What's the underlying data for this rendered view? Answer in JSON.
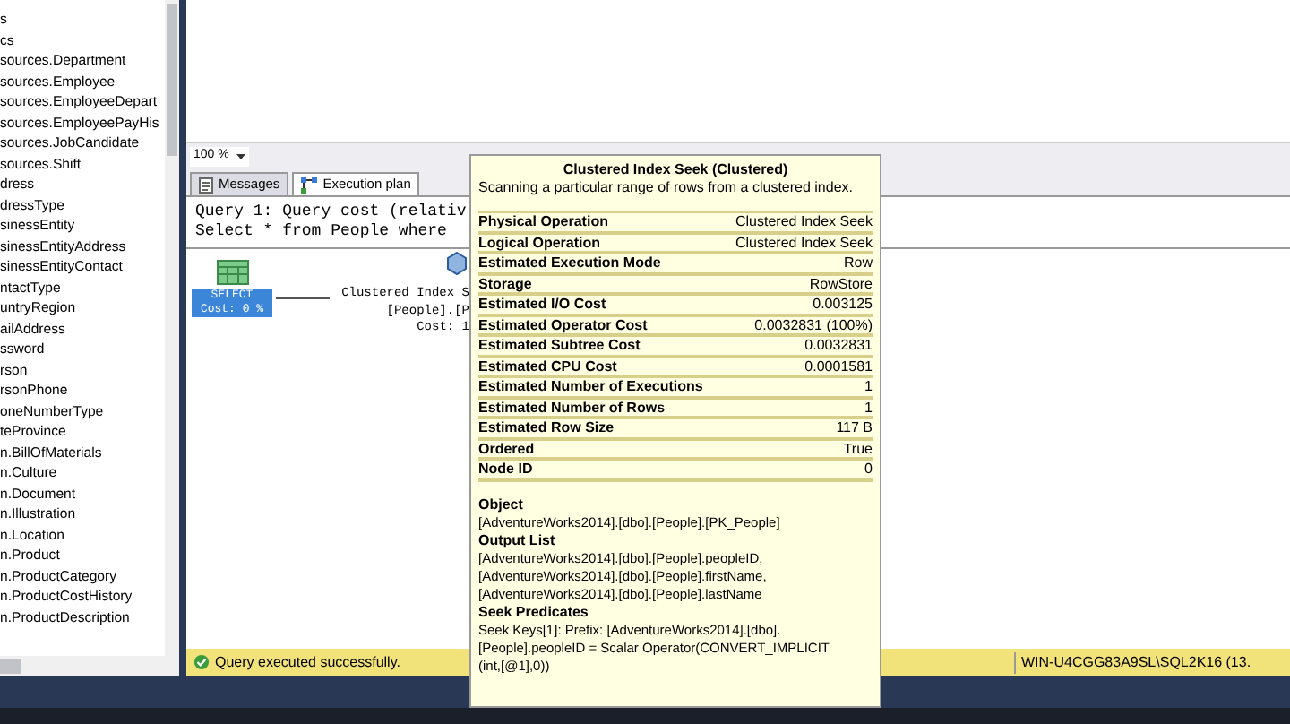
{
  "object_explorer": {
    "items": [
      "s",
      "cs",
      "sources.Department",
      "sources.Employee",
      "sources.EmployeeDepart",
      "sources.EmployeePayHis",
      "sources.JobCandidate",
      "sources.Shift",
      "dress",
      "dressType",
      "sinessEntity",
      "sinessEntityAddress",
      "sinessEntityContact",
      "ntactType",
      "untryRegion",
      "ailAddress",
      "ssword",
      "rson",
      "rsonPhone",
      "oneNumberType",
      "teProvince",
      "n.BillOfMaterials",
      "n.Culture",
      "n.Document",
      "n.Illustration",
      "n.Location",
      "n.Product",
      "n.ProductCategory",
      "n.ProductCostHistory",
      "n.ProductDescription"
    ]
  },
  "zoom": {
    "value": "100 %"
  },
  "tabs": [
    {
      "label": "Messages",
      "selected": false
    },
    {
      "label": "Execution plan",
      "selected": true
    }
  ],
  "plan": {
    "query_lines": [
      "Query 1: Query cost (relativ",
      "Select * from People where "
    ],
    "select_node": {
      "label": "SELECT",
      "cost": "Cost: 0 %",
      "selected": true
    },
    "seek_node": {
      "lines": [
        "Clustered Index S",
        "[People].[P",
        "Cost: 1"
      ]
    }
  },
  "tooltip": {
    "title": "Clustered Index Seek (Clustered)",
    "description": "Scanning a particular range of rows from a clustered index.",
    "properties": [
      {
        "name": "Physical Operation",
        "value": "Clustered Index Seek"
      },
      {
        "name": "Logical Operation",
        "value": "Clustered Index Seek"
      },
      {
        "name": "Estimated Execution Mode",
        "value": "Row"
      },
      {
        "name": "Storage",
        "value": "RowStore"
      },
      {
        "name": "Estimated I/O Cost",
        "value": "0.003125"
      },
      {
        "name": "Estimated Operator Cost",
        "value": "0.0032831 (100%)"
      },
      {
        "name": "Estimated Subtree Cost",
        "value": "0.0032831"
      },
      {
        "name": "Estimated CPU Cost",
        "value": "0.0001581"
      },
      {
        "name": "Estimated Number of Executions",
        "value": "1"
      },
      {
        "name": "Estimated Number of Rows",
        "value": "1"
      },
      {
        "name": "Estimated Row Size",
        "value": "117 B"
      },
      {
        "name": "Ordered",
        "value": "True"
      },
      {
        "name": "Node ID",
        "value": "0"
      }
    ],
    "sections": [
      {
        "heading": "Object",
        "lines": [
          "[AdventureWorks2014].[dbo].[People].[PK_People]"
        ]
      },
      {
        "heading": "Output List",
        "lines": [
          "[AdventureWorks2014].[dbo].[People].peopleID,",
          "[AdventureWorks2014].[dbo].[People].firstName,",
          "[AdventureWorks2014].[dbo].[People].lastName"
        ]
      },
      {
        "heading": "Seek Predicates",
        "lines": [
          "Seek Keys[1]: Prefix: [AdventureWorks2014].[dbo].",
          "[People].peopleID = Scalar Operator(CONVERT_IMPLICIT",
          "(int,[@1],0))"
        ]
      }
    ]
  },
  "status_bar": {
    "message": "Query executed successfully.",
    "server": "WIN-U4CGG83A9SL\\SQL2K16 (13."
  }
}
